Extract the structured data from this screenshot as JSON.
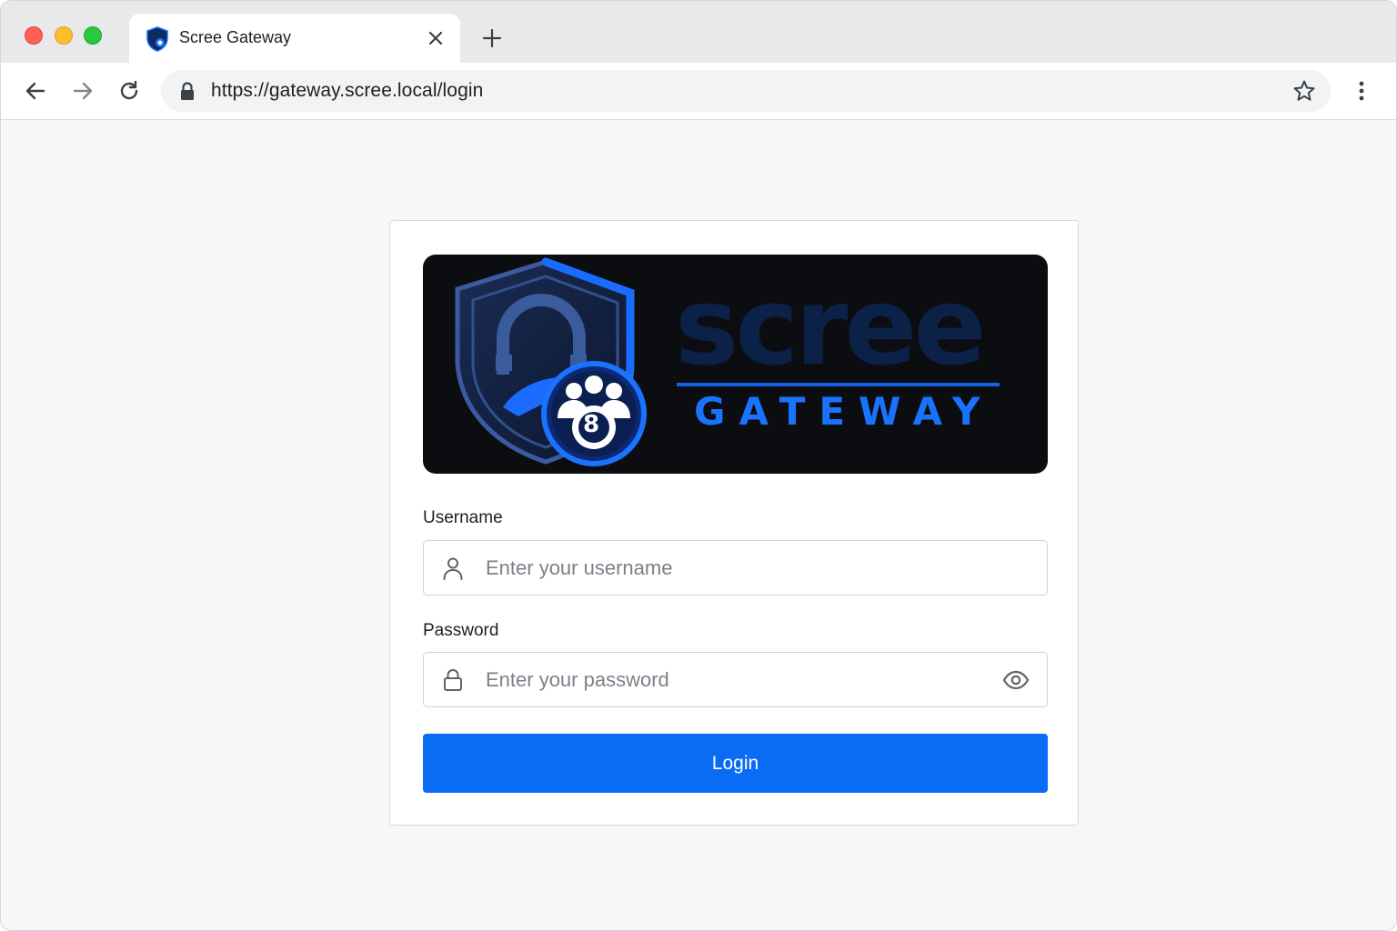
{
  "browser": {
    "tab": {
      "title": "Scree Gateway",
      "favicon": "shield-icon"
    },
    "toolbar": {
      "url": "https://gateway.scree.local/login",
      "icons": [
        "back-arrow-icon",
        "forward-arrow-icon",
        "reload-icon",
        "lock-icon",
        "star-icon",
        "kebab-menu-icon"
      ]
    }
  },
  "login": {
    "logo": {
      "word": "scree",
      "subtitle": "GATEWAY",
      "badge_number": "8"
    },
    "username": {
      "label": "Username",
      "placeholder": "Enter your username",
      "value": ""
    },
    "password": {
      "label": "Password",
      "placeholder": "Enter your password",
      "value": ""
    },
    "submit_label": "Login"
  },
  "colors": {
    "accent": "#0a6cf5",
    "logo_background": "#0c0d10",
    "logo_blue": "#1a73ff",
    "page_background": "#f6f7f9"
  }
}
